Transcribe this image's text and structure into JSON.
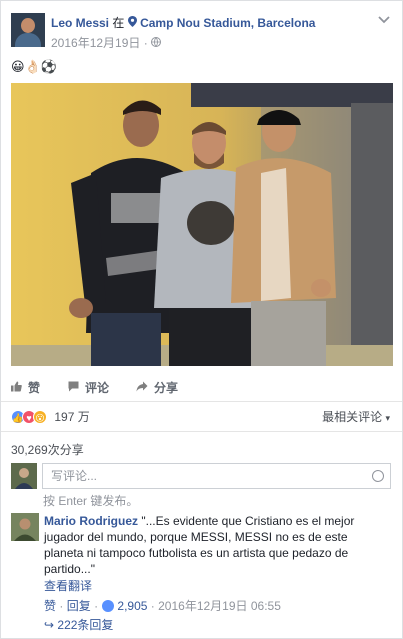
{
  "post": {
    "author": "Leo Messi",
    "at_word": "在",
    "location": "Camp Nou Stadium, Barcelona",
    "date": "2016年12月19日",
    "visibility_sep": "·",
    "emojis": "😀👌🏻⚽"
  },
  "actions": {
    "like": "赞",
    "comment": "评论",
    "share": "分享"
  },
  "reactions": {
    "count": "197 万",
    "sort_label": "最相关评论",
    "sort_arrow": "▾",
    "like_color": "#5890ff",
    "love_color": "#f25268",
    "wow_color": "#f7b125"
  },
  "shares_text": "30,269次分享",
  "composer": {
    "placeholder": "写评论...",
    "hint": "按 Enter 键发布。"
  },
  "top_comment": {
    "author": "Mario Rodriguez",
    "text": "\"...Es evidente que Cristiano es el mejor jugador del mundo, porque MESSI, MESSI no es de este planeta ni tampoco futbolista es un artista que pedazo de partido...\"",
    "translate": "查看翻译",
    "like": "赞",
    "reply": "回复",
    "likes": "2,905",
    "date": "2016年12月19日 06:55",
    "replies": "222条回复",
    "replies_arrow": "↪"
  }
}
